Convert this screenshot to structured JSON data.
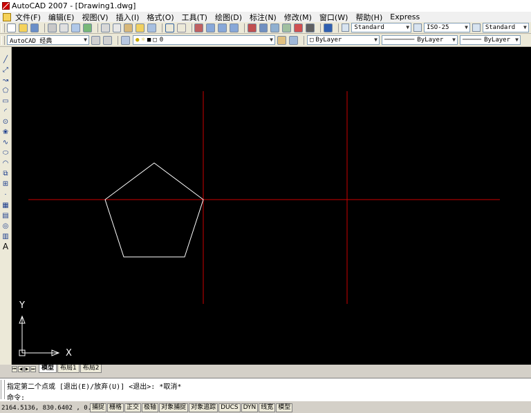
{
  "window": {
    "title": "AutoCAD 2007 - [Drawing1.dwg]"
  },
  "menubar": {
    "items": [
      "文件(F)",
      "编辑(E)",
      "视图(V)",
      "插入(I)",
      "格式(O)",
      "工具(T)",
      "绘图(D)",
      "标注(N)",
      "修改(M)",
      "窗口(W)",
      "帮助(H)",
      "Express"
    ]
  },
  "toolbar_styles": {
    "text_style": "Standard",
    "dim_style": "ISO-25",
    "table_style": "Standard"
  },
  "toolbar_layers": {
    "workspace": "AutoCAD 经典",
    "layer": "0",
    "color": "ByLayer",
    "linetype": "ByLayer",
    "lineweight": "ByLayer"
  },
  "left_toolbar": {
    "tools": [
      "line-icon",
      "construction-line-icon",
      "polyline-icon",
      "polygon-icon",
      "rectangle-icon",
      "arc-icon",
      "circle-icon",
      "revision-cloud-icon",
      "spline-icon",
      "ellipse-icon",
      "ellipse-arc-icon",
      "insert-block-icon",
      "make-block-icon",
      "point-icon",
      "hatch-icon",
      "gradient-icon",
      "region-icon",
      "table-icon",
      "multiline-text-icon"
    ],
    "text_tool_label": "A"
  },
  "canvas": {
    "background": "#000000",
    "crosshair_color": "#cc0000",
    "geometry_color": "#ffffff",
    "ucs_x_label": "X",
    "ucs_y_label": "Y"
  },
  "tabs": {
    "items": [
      "模型",
      "布局1",
      "布局2"
    ],
    "active": "模型"
  },
  "command": {
    "line1": "指定第二个点或 [退出(E)/放弃(U)] <退出>:  *取消*",
    "line2": "命令:"
  },
  "statusbar": {
    "coords": "2164.5136, 830.6402 , 0.0000",
    "buttons": [
      "捕捉",
      "栅格",
      "正交",
      "极轴",
      "对象捕捉",
      "对象追踪",
      "DUCS",
      "DYN",
      "线宽",
      "模型"
    ]
  }
}
